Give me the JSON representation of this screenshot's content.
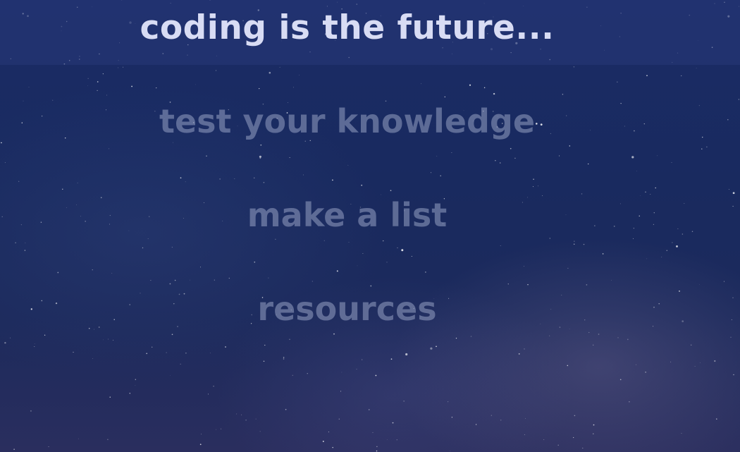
{
  "header": {
    "title": "coding is the future..."
  },
  "menu": {
    "items": [
      {
        "label": "test your knowledge"
      },
      {
        "label": "make a list"
      },
      {
        "label": "resources"
      }
    ]
  },
  "colors": {
    "background": "#1a2c66",
    "header_bar": "#283878",
    "title_text": "#d8dcf4",
    "menu_text": "#969fc3"
  }
}
